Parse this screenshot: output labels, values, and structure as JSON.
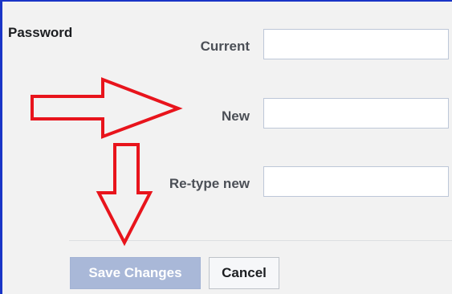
{
  "section": {
    "title": "Password"
  },
  "fields": {
    "current": {
      "label": "Current",
      "value": ""
    },
    "new": {
      "label": "New",
      "value": ""
    },
    "retype": {
      "label": "Re-type new",
      "value": ""
    }
  },
  "buttons": {
    "save_label": "Save Changes",
    "cancel_label": "Cancel"
  },
  "annotations": {
    "arrow_color": "#e8141c",
    "frame_color": "#1a35c7"
  }
}
